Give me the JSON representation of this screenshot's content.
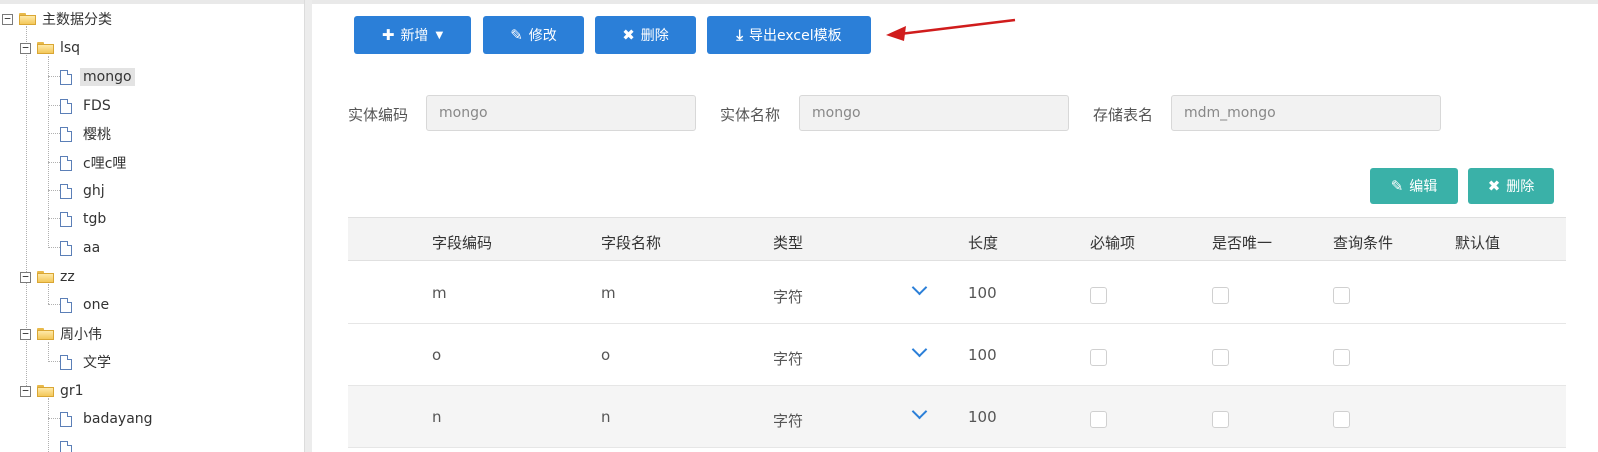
{
  "tree": {
    "root": "主数据分类",
    "groups": [
      {
        "label": "lsq",
        "children": [
          "mongo",
          "FDS",
          "樱桃",
          "c哩c哩",
          "ghj",
          "tgb",
          "aa"
        ]
      },
      {
        "label": "zz",
        "children": [
          "one"
        ]
      },
      {
        "label": "周小伟",
        "children": [
          "文学"
        ]
      },
      {
        "label": "gr1",
        "children": [
          "badayang"
        ]
      }
    ],
    "selected": "mongo"
  },
  "toolbar": {
    "add": "新增",
    "edit": "修改",
    "delete": "删除",
    "export": "导出excel模板"
  },
  "form": {
    "entity_code_label": "实体编码",
    "entity_code_value": "mongo",
    "entity_name_label": "实体名称",
    "entity_name_value": "mongo",
    "table_name_label": "存储表名",
    "table_name_value": "mdm_mongo"
  },
  "table_actions": {
    "edit": "编辑",
    "delete": "删除"
  },
  "table": {
    "headers": [
      "字段编码",
      "字段名称",
      "类型",
      "长度",
      "必输项",
      "是否唯一",
      "查询条件",
      "默认值"
    ],
    "rows": [
      {
        "code": "m",
        "name": "m",
        "type": "字符",
        "length": "100"
      },
      {
        "code": "o",
        "name": "o",
        "type": "字符",
        "length": "100"
      },
      {
        "code": "n",
        "name": "n",
        "type": "字符",
        "length": "100"
      }
    ]
  },
  "colors": {
    "primary": "#2b7fd8",
    "teal": "#3ab1a8",
    "arrow": "#d01c1c"
  }
}
